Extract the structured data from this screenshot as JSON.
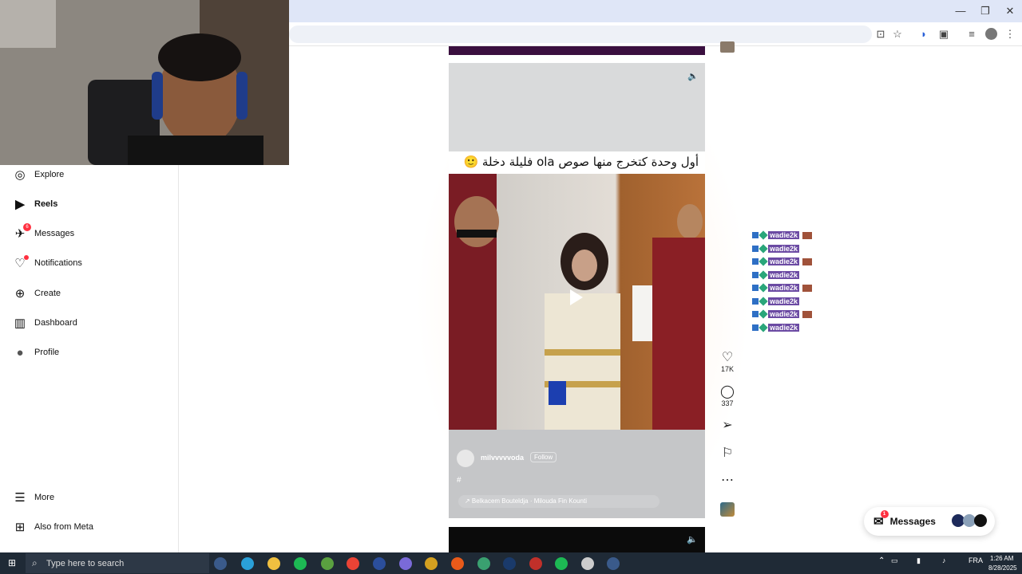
{
  "browser": {
    "window_controls": {
      "minimize": "—",
      "restore": "❐",
      "close": "✕"
    }
  },
  "sidebar": {
    "items": [
      {
        "label": "Explore",
        "icon": "compass-icon",
        "glyph": "◎"
      },
      {
        "label": "Reels",
        "icon": "reels-icon",
        "glyph": "▶"
      },
      {
        "label": "Messages",
        "icon": "messenger-icon",
        "glyph": "✈",
        "badge": "6"
      },
      {
        "label": "Notifications",
        "icon": "heart-icon",
        "glyph": "♡"
      },
      {
        "label": "Create",
        "icon": "plus-square-icon",
        "glyph": "⊕"
      },
      {
        "label": "Dashboard",
        "icon": "chart-icon",
        "glyph": "▥"
      },
      {
        "label": "Profile",
        "icon": "avatar-icon",
        "glyph": "●"
      }
    ],
    "more": "More",
    "also_from_meta": "Also from Meta"
  },
  "reel": {
    "caption": "أول وحدة كتخرج منها صوص ola فليلة دخلة 🙂",
    "author": "milvvvvvoda",
    "follow": "Follow",
    "hashtag": "#",
    "audio": "↗ Belkacem Bouteldja · Milouda Fin Kounti",
    "likes": "17K",
    "comments": "337"
  },
  "chat_overlay": {
    "username": "wadie2k",
    "line_count": 8
  },
  "messages_pill": {
    "label": "Messages",
    "badge": "1"
  },
  "taskbar": {
    "search_placeholder": "Type here to search",
    "language": "FRA",
    "time": "1:26 AM",
    "date": "8/28/2025"
  }
}
